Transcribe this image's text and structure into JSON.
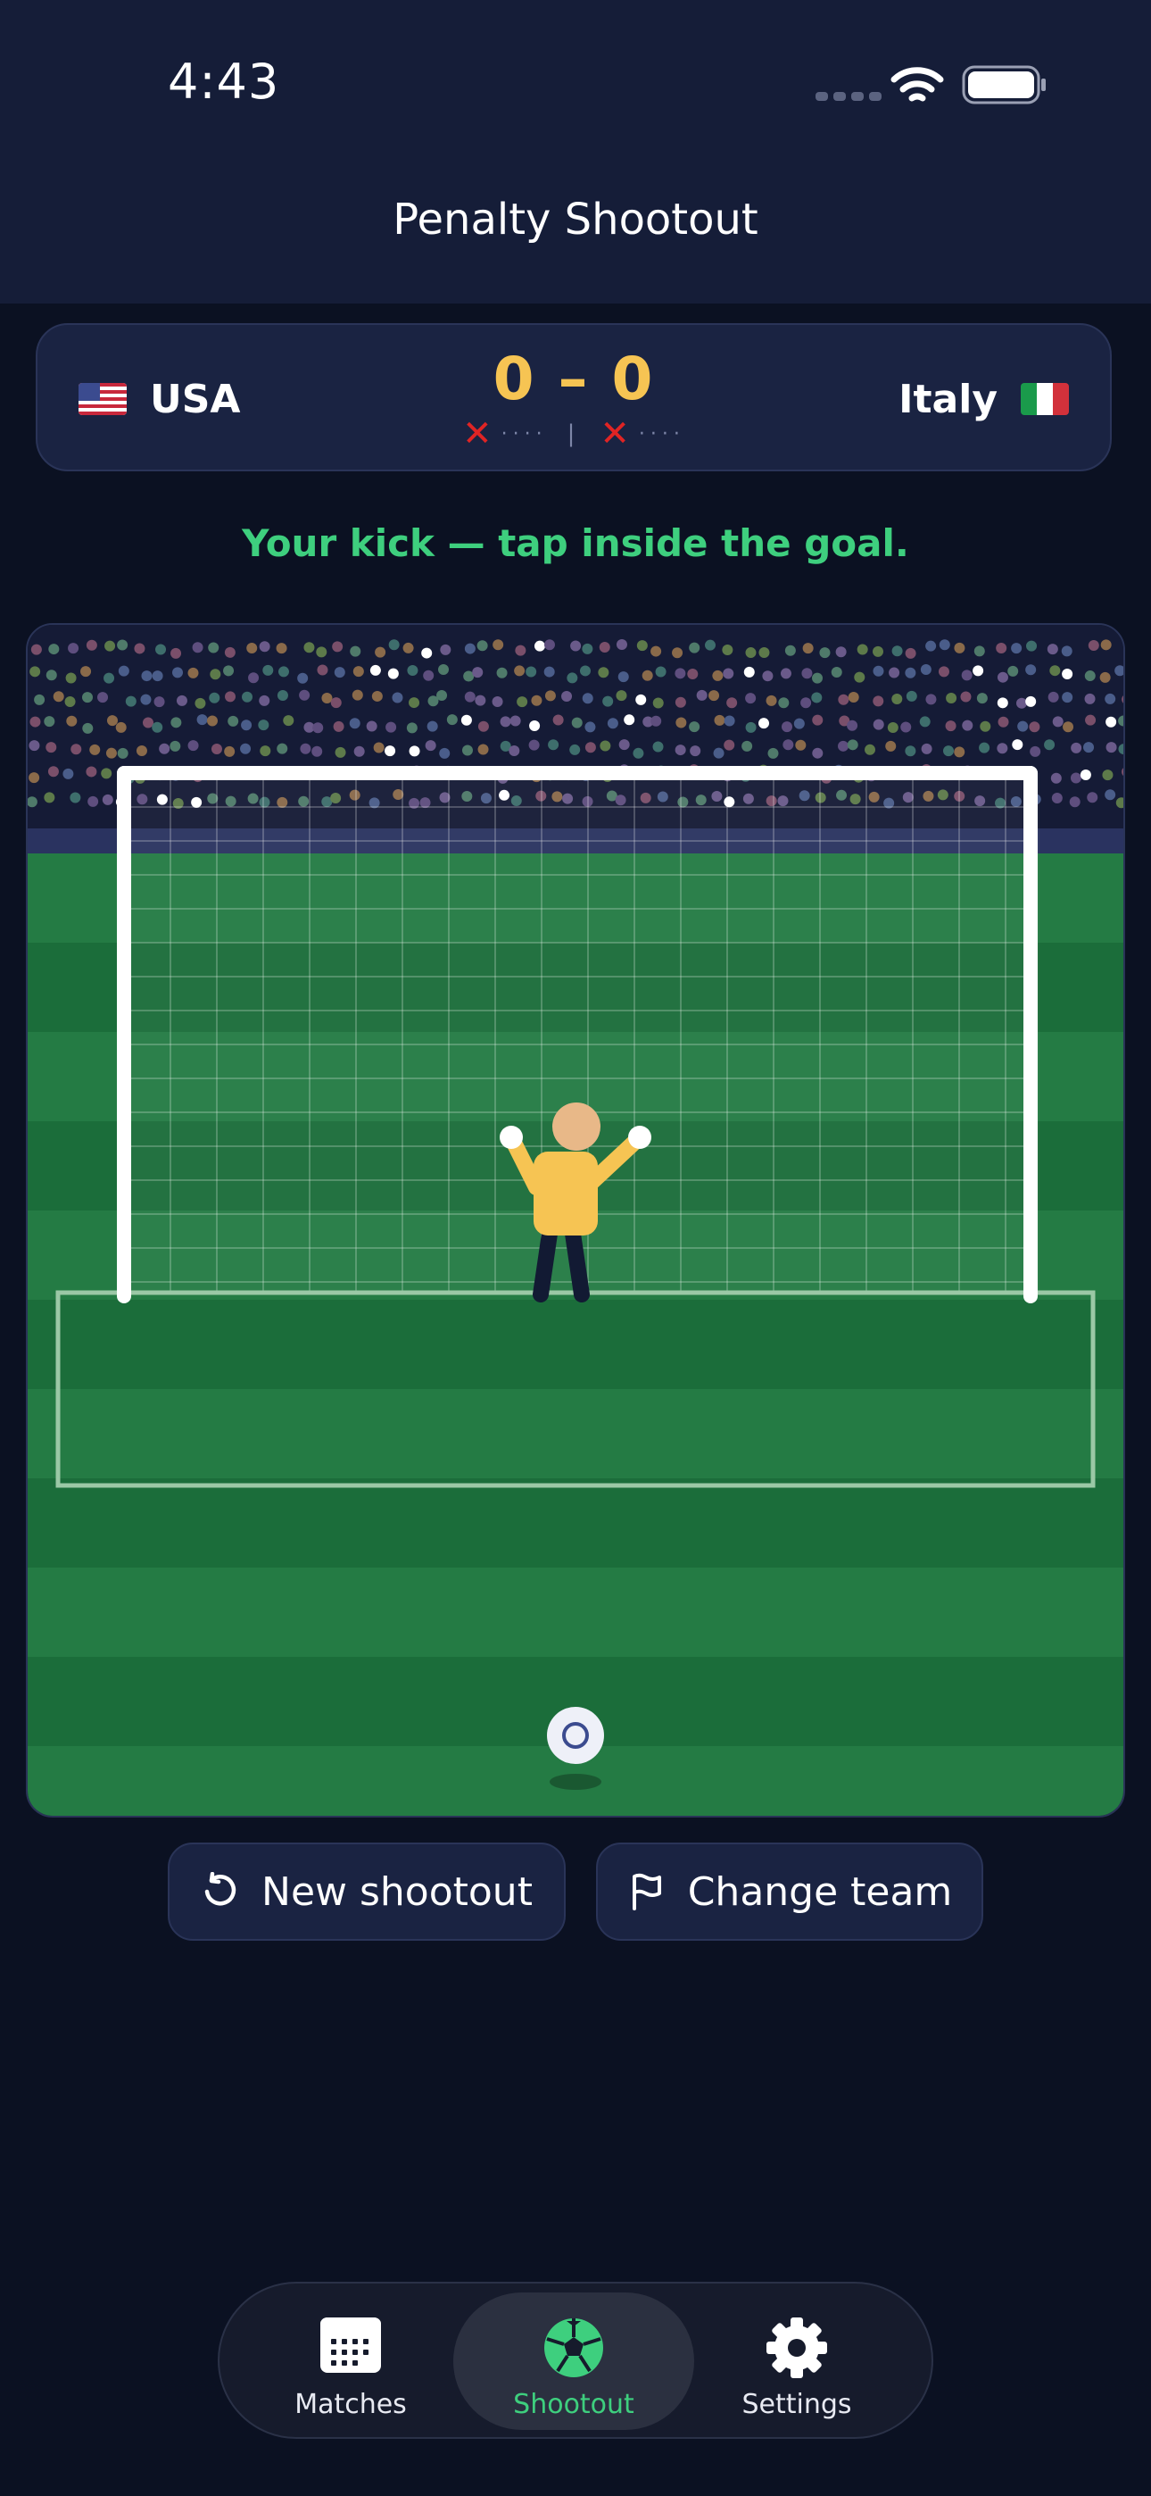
{
  "status_bar": {
    "time": "4:43"
  },
  "nav": {
    "title": "Penalty Shootout"
  },
  "scoreboard": {
    "home_team": "USA",
    "away_team": "Italy",
    "score": "0 – 0",
    "home_kicks": [
      "miss",
      "pending",
      "pending",
      "pending",
      "pending"
    ],
    "away_kicks": [
      "miss",
      "pending",
      "pending",
      "pending",
      "pending"
    ],
    "miss_color": "#e02424"
  },
  "prompt": {
    "text": "Your kick — tap inside the goal."
  },
  "buttons": {
    "new_shootout": "New shootout",
    "change_team": "Change team"
  },
  "tabs": [
    {
      "label": "Matches",
      "icon": "calendar-icon",
      "selected": false
    },
    {
      "label": "Shootout",
      "icon": "soccer-ball-icon",
      "selected": true
    },
    {
      "label": "Settings",
      "icon": "gear-icon",
      "selected": false
    }
  ],
  "colors": {
    "accent": "#3ecf7e",
    "score": "#f6c453",
    "background": "#0b1122",
    "card": "#1a2342",
    "pitch_light": "#247b44",
    "pitch_dark": "#1b6d3a"
  }
}
